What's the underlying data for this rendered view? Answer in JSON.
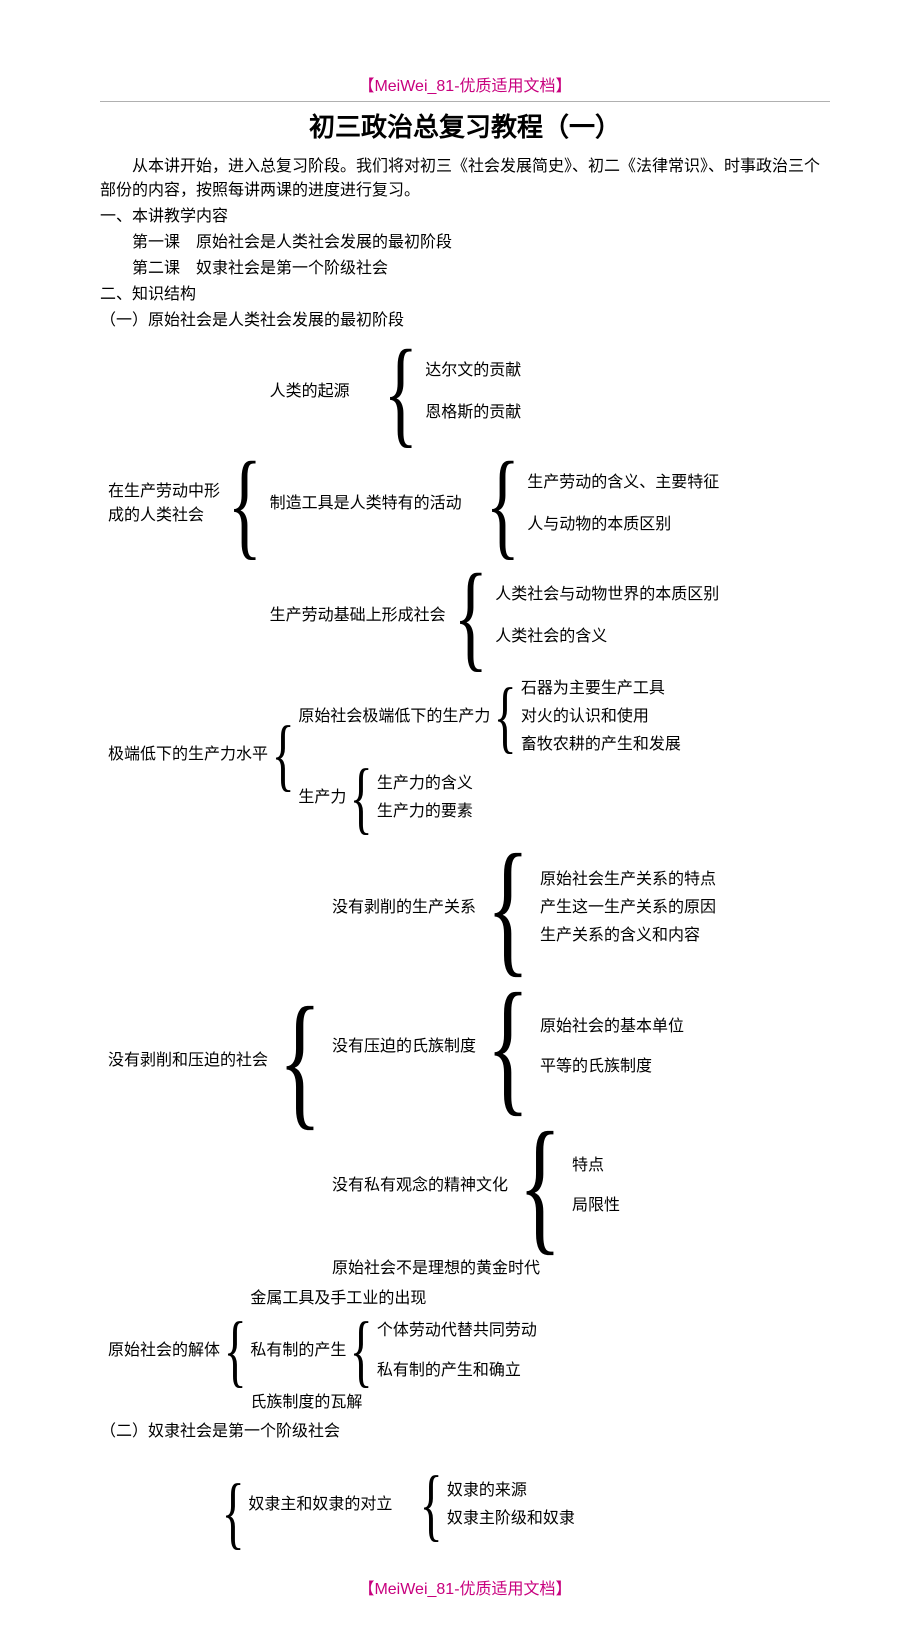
{
  "header": "【MeiWei_81-优质适用文档】",
  "footer": "【MeiWei_81-优质适用文档】",
  "title": "初三政治总复习教程（一）",
  "intro": "从本讲开始，进入总复习阶段。我们将对初三《社会发展简史》、初二《法律常识》、时事政治三个部份的内容，按照每讲两课的进度进行复习。",
  "sec1": {
    "heading": "一、本讲教学内容",
    "l1": "第一课　原始社会是人类社会发展的最初阶段",
    "l2": "第二课　奴隶社会是第一个阶级社会"
  },
  "sec2": {
    "heading": "二、知识结构",
    "p1": "（一）原始社会是人类社会发展的最初阶段",
    "p2": "（二）奴隶社会是第一个阶级社会"
  },
  "t": {
    "a": {
      "root": "在生产劳动中形",
      "root2": "成的人类社会",
      "b1": {
        "label": "人类的起源",
        "c1": "达尔文的贡献",
        "c2": "恩格斯的贡献"
      },
      "b2": {
        "label": "制造工具是人类特有的活动",
        "c1": "生产劳动的含义、主要特征",
        "c2": "人与动物的本质区别"
      },
      "b3": {
        "label": "生产劳动基础上形成社会",
        "c1": "人类社会与动物世界的本质区别",
        "c2": "人类社会的含义"
      }
    },
    "b": {
      "root": "极端低下的生产力水平",
      "b1": {
        "label": "原始社会极端低下的生产力",
        "c1": "石器为主要生产工具",
        "c2": "对火的认识和使用",
        "c3": "畜牧农耕的产生和发展"
      },
      "b2": {
        "label": "生产力",
        "c1": "生产力的含义",
        "c2": "生产力的要素"
      }
    },
    "c": {
      "root": "没有剥削和压迫的社会",
      "b1": {
        "label": "没有剥削的生产关系",
        "c1": "原始社会生产关系的特点",
        "c2": "产生这一生产关系的原因",
        "c3": "生产关系的含义和内容"
      },
      "b2": {
        "label": "没有压迫的氏族制度",
        "c1": "原始社会的基本单位",
        "c2": "平等的氏族制度"
      },
      "b3": {
        "label": "没有私有观念的精神文化",
        "c1": "特点",
        "c2": "局限性"
      },
      "b4": "原始社会不是理想的黄金时代"
    },
    "d": {
      "root": "原始社会的解体",
      "b1": "金属工具及手工业的出现",
      "b2": {
        "label": "私有制的产生",
        "c1": "个体劳动代替共同劳动",
        "c2": "私有制的产生和确立"
      },
      "b3": "氏族制度的瓦解"
    },
    "e": {
      "b1": {
        "label": "奴隶主和奴隶的对立",
        "c1": "奴隶的来源",
        "c2": "奴隶主阶级和奴隶"
      }
    }
  }
}
